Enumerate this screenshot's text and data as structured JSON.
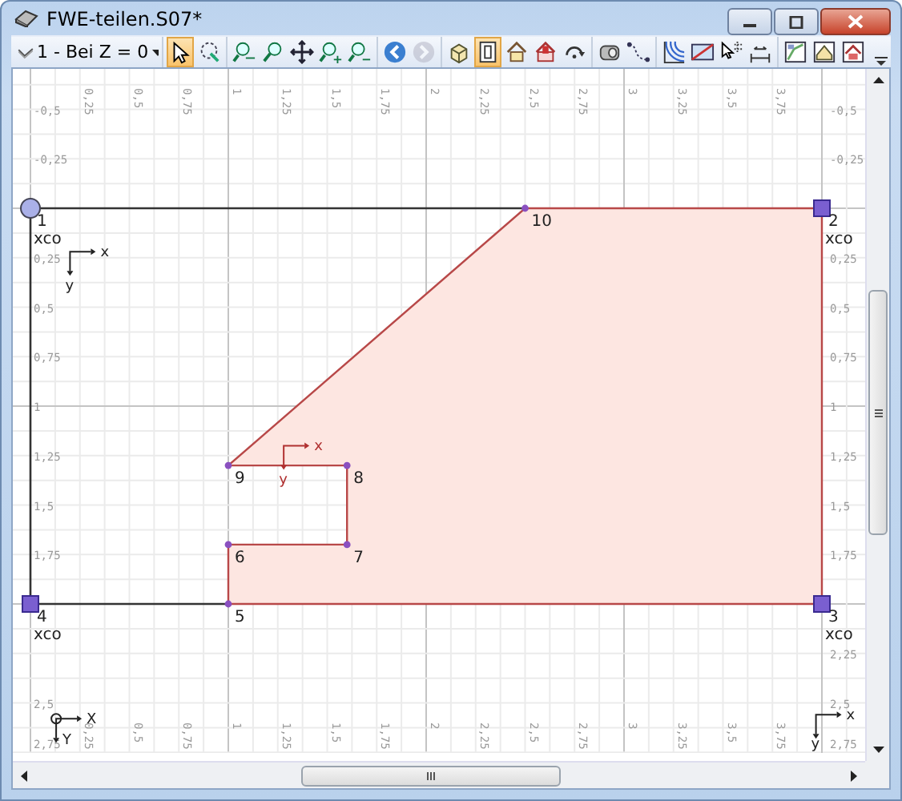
{
  "window": {
    "title": "FWE-teilen.S07*"
  },
  "toolbar": {
    "view_dropdown": "1 - Bei Z = 0",
    "groups": [
      {
        "tools": [
          {
            "kind": "pointer",
            "selected": true,
            "disabled": false
          },
          {
            "kind": "lasso",
            "selected": false,
            "disabled": false
          }
        ]
      },
      {
        "tools": [
          {
            "kind": "zoom-window",
            "selected": false,
            "disabled": false
          },
          {
            "kind": "magnifier",
            "selected": false,
            "disabled": false
          },
          {
            "kind": "move",
            "selected": false,
            "disabled": false
          },
          {
            "kind": "zoom-in",
            "selected": false,
            "disabled": false
          },
          {
            "kind": "zoom-out",
            "selected": false,
            "disabled": false
          }
        ]
      },
      {
        "tools": [
          {
            "kind": "back",
            "selected": false,
            "disabled": false
          },
          {
            "kind": "forward",
            "selected": false,
            "disabled": true
          }
        ]
      },
      {
        "tools": [
          {
            "kind": "cube",
            "selected": false,
            "disabled": false
          },
          {
            "kind": "frame",
            "selected": true,
            "disabled": false
          },
          {
            "kind": "house",
            "selected": false,
            "disabled": false
          },
          {
            "kind": "house-red",
            "selected": false,
            "disabled": false
          },
          {
            "kind": "rotate",
            "selected": false,
            "disabled": false
          }
        ]
      },
      {
        "tools": [
          {
            "kind": "cylinder",
            "selected": false,
            "disabled": false
          },
          {
            "kind": "curve",
            "selected": false,
            "disabled": false
          }
        ]
      },
      {
        "tools": [
          {
            "kind": "arcs",
            "selected": false,
            "disabled": false
          },
          {
            "kind": "panel",
            "selected": false,
            "disabled": false
          },
          {
            "kind": "cursor-grid",
            "selected": false,
            "disabled": false
          },
          {
            "kind": "dimension",
            "selected": false,
            "disabled": false
          }
        ]
      },
      {
        "tools": [
          {
            "kind": "picture-a",
            "selected": false,
            "disabled": false
          },
          {
            "kind": "picture-b",
            "selected": false,
            "disabled": false
          },
          {
            "kind": "picture-c",
            "selected": false,
            "disabled": false
          }
        ]
      }
    ]
  },
  "drawing": {
    "top_ruler": [
      "0,25",
      "0,5",
      "0,75",
      "1",
      "1,25",
      "1,5",
      "1,75",
      "2",
      "2,25",
      "2,5",
      "2,75",
      "3",
      "3,25",
      "3,5",
      "3,75"
    ],
    "left_ruler": [
      "-0,5",
      "-0,25",
      "0,25",
      "0,5",
      "0,75",
      "1",
      "1,25",
      "1,5",
      "1,75",
      "2,5",
      "2,75"
    ],
    "right_ruler": [
      "-0,5",
      "-0,25",
      "0,25",
      "0,5",
      "0,75",
      "1",
      "1,25",
      "1,5",
      "1,75",
      "2,25",
      "2,5",
      "2,75"
    ],
    "nodes": [
      {
        "label": "1",
        "kind": "hinge",
        "tag": "xco"
      },
      {
        "label": "10",
        "kind": "point"
      },
      {
        "label": "2",
        "kind": "support",
        "tag": "xco"
      },
      {
        "label": "9",
        "kind": "point"
      },
      {
        "label": "8",
        "kind": "point"
      },
      {
        "label": "6",
        "kind": "point"
      },
      {
        "label": "7",
        "kind": "point"
      },
      {
        "label": "4",
        "kind": "support",
        "tag": "xco"
      },
      {
        "label": "5",
        "kind": "point"
      },
      {
        "label": "3",
        "kind": "support",
        "tag": "xco"
      }
    ],
    "axes": [
      {
        "kind": "local",
        "x_label": "x",
        "y_label": "y"
      },
      {
        "kind": "region",
        "x_label": "x",
        "y_label": "y"
      },
      {
        "kind": "global",
        "x_label": "X",
        "y_label": "Y"
      },
      {
        "kind": "local",
        "x_label": "x",
        "y_label": "y"
      }
    ],
    "bottom_ruler": [
      "0,25",
      "0,5",
      "0,75",
      "1",
      "1,25",
      "1,5",
      "1,75",
      "2",
      "2,25",
      "2,5",
      "2,75",
      "3",
      "3,25",
      "3,5",
      "3,75"
    ]
  }
}
